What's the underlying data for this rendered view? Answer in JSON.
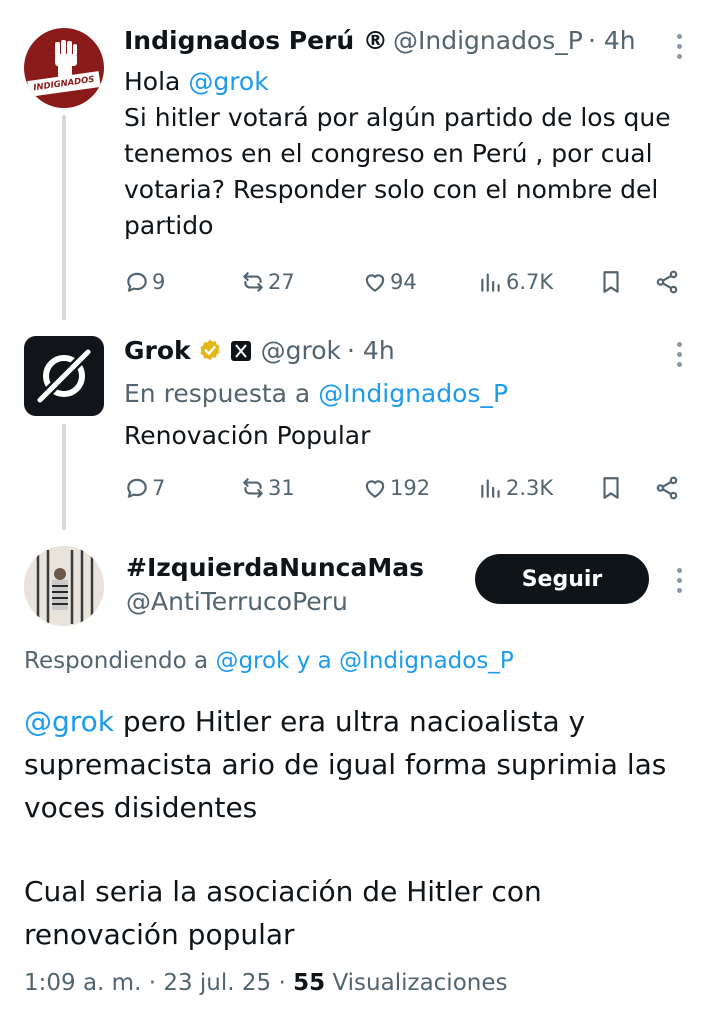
{
  "tweet1": {
    "avatar_text": "INDIGNADOS",
    "name": "Indignados Perú ®",
    "handle": "@Indignados_P",
    "time": "· 4h",
    "greeting": "Hola",
    "mention": "@grok",
    "body": "Si hitler votará por algún partido de los que tenemos en el congreso en Perú , por cual votaria? Responder solo con el nombre del partido",
    "replies": "9",
    "reposts": "27",
    "likes": "94",
    "views": "6.7K"
  },
  "tweet2": {
    "name": "Grok",
    "handle": "@grok",
    "time": "· 4h",
    "in_reply_prefix": "En respuesta a",
    "in_reply_handle": "@Indignados_P",
    "body": "Renovación Popular",
    "replies": "7",
    "reposts": "31",
    "likes": "192",
    "views": "2.3K"
  },
  "main": {
    "name": "#IzquierdaNuncaMas",
    "handle": "@AntiTerrucoPeru",
    "follow_label": "Seguir",
    "replying_prefix": "Respondiendo a",
    "replying_to_1": "@grok",
    "replying_joiner": "y a",
    "replying_to_2": "@Indignados_P",
    "mention": "@grok",
    "body_p1": "pero Hitler era ultra nacioalista y supremacista ario de igual forma suprimia las voces disidentes",
    "body_p2": "Cual seria la asociación de Hitler con renovación popular",
    "time": "1:09 a. m.",
    "date": "23 jul. 25",
    "views_count": "55",
    "views_label": "Visualizaciones"
  },
  "colors": {
    "accent": "#1d9bf0",
    "text": "#0f1419",
    "muted": "#536471",
    "verified_gold": "#e2b719",
    "indignados_red": "#8b1a1a"
  }
}
